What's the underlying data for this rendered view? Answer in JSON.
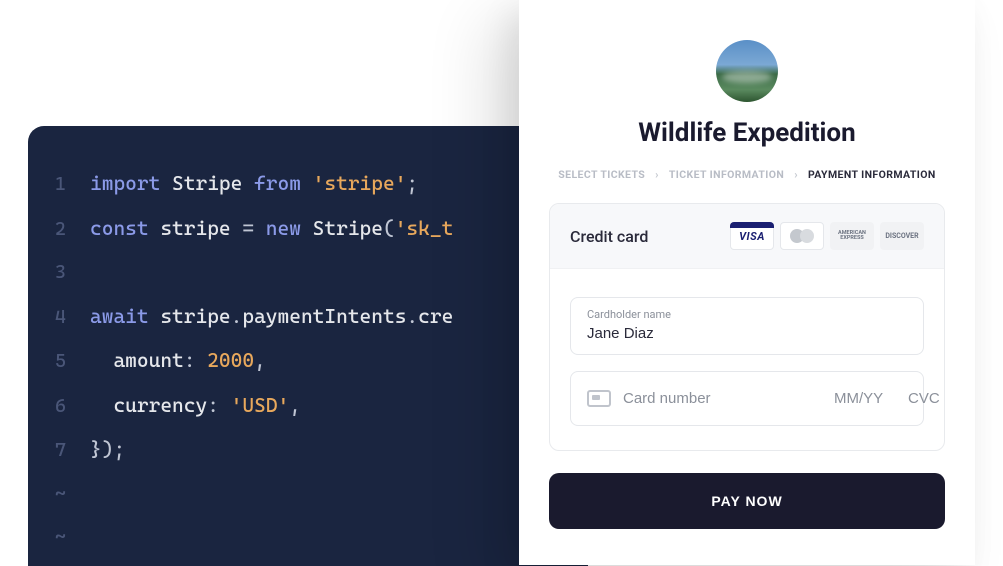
{
  "code": {
    "lines": [
      {
        "num": "1",
        "tokens": [
          {
            "t": "import",
            "c": "keyword"
          },
          {
            "t": " "
          },
          {
            "t": "Stripe",
            "c": "ident"
          },
          {
            "t": " "
          },
          {
            "t": "from",
            "c": "keyword"
          },
          {
            "t": " "
          },
          {
            "t": "'stripe'",
            "c": "string"
          },
          {
            "t": ";",
            "c": "punct"
          }
        ]
      },
      {
        "num": "2",
        "tokens": [
          {
            "t": "const",
            "c": "keyword"
          },
          {
            "t": " "
          },
          {
            "t": "stripe",
            "c": "ident"
          },
          {
            "t": " ",
            "c": "punct"
          },
          {
            "t": "=",
            "c": "punct"
          },
          {
            "t": " "
          },
          {
            "t": "new",
            "c": "keyword"
          },
          {
            "t": " "
          },
          {
            "t": "Stripe",
            "c": "ident"
          },
          {
            "t": "(",
            "c": "punct"
          },
          {
            "t": "'sk_t",
            "c": "string"
          }
        ]
      },
      {
        "num": "3",
        "tokens": []
      },
      {
        "num": "4",
        "tokens": [
          {
            "t": "await",
            "c": "keyword"
          },
          {
            "t": " "
          },
          {
            "t": "stripe",
            "c": "ident"
          },
          {
            "t": ".",
            "c": "punct"
          },
          {
            "t": "paymentIntents",
            "c": "prop"
          },
          {
            "t": ".",
            "c": "punct"
          },
          {
            "t": "cre",
            "c": "prop"
          }
        ]
      },
      {
        "num": "5",
        "tokens": [
          {
            "t": "  "
          },
          {
            "t": "amount",
            "c": "prop"
          },
          {
            "t": ":",
            "c": "punct"
          },
          {
            "t": " "
          },
          {
            "t": "2000",
            "c": "number"
          },
          {
            "t": ",",
            "c": "punct"
          }
        ]
      },
      {
        "num": "6",
        "tokens": [
          {
            "t": "  "
          },
          {
            "t": "currency",
            "c": "prop"
          },
          {
            "t": ":",
            "c": "punct"
          },
          {
            "t": " "
          },
          {
            "t": "'USD'",
            "c": "string"
          },
          {
            "t": ",",
            "c": "punct"
          }
        ]
      },
      {
        "num": "7",
        "tokens": [
          {
            "t": "});",
            "c": "punct"
          }
        ]
      },
      {
        "num": "~",
        "tokens": []
      },
      {
        "num": "~",
        "tokens": []
      }
    ]
  },
  "payment": {
    "merchant_title": "Wildlife Expedition",
    "breadcrumb": {
      "step1": "SELECT TICKETS",
      "step2": "TICKET INFORMATION",
      "step3": "PAYMENT INFORMATION"
    },
    "cc_title": "Credit card",
    "brands": {
      "visa": "VISA",
      "amex": "AMERICAN EXPRESS",
      "discover": "DISCOVER"
    },
    "cardholder": {
      "label": "Cardholder name",
      "value": "Jane Diaz"
    },
    "card_number_placeholder": "Card number",
    "expiry_placeholder": "MM/YY",
    "cvc_placeholder": "CVC",
    "pay_button_label": "PAY NOW"
  }
}
